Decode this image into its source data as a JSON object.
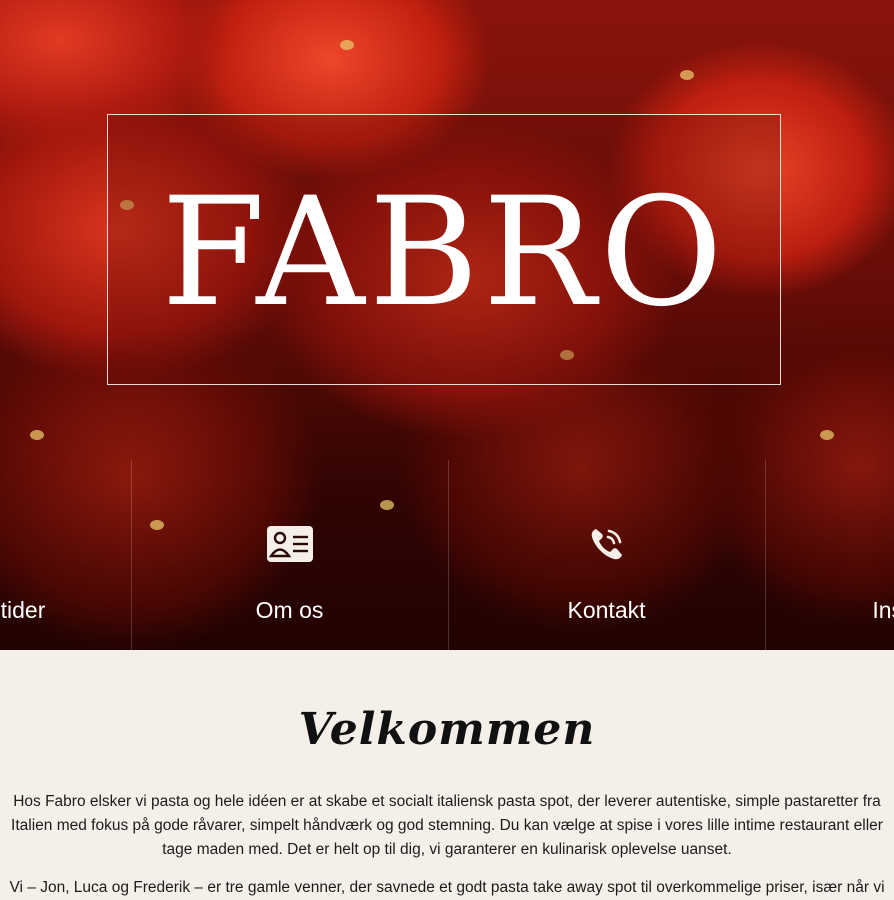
{
  "brand": {
    "logo_text": "FABRO"
  },
  "nav": {
    "items": [
      {
        "label": "Retter og tider",
        "icon": "menu-icon"
      },
      {
        "label": "Om os",
        "icon": "id-card-icon"
      },
      {
        "label": "Kontakt",
        "icon": "phone-icon"
      },
      {
        "label": "Instagram",
        "icon": "instagram-icon"
      }
    ]
  },
  "welcome": {
    "title": "Velkommen",
    "paragraph_1": "Hos Fabro elsker vi pasta og hele idéen er at skabe et socialt italiensk pasta spot, der leverer autentiske, simple pastaretter fra Italien med fokus på gode råvarer, simpelt håndværk og god stemning. Du kan vælge at spise i vores lille intime restaurant eller tage maden med. Det er helt op til dig, vi garanterer en kulinarisk oplevelse uanset.",
    "paragraph_2": "Vi – Jon, Luca og Frederik – er tre gamle venner, der savnede et godt pasta take away spot til overkommelige priser, især når vi"
  },
  "colors": {
    "hero_red": "#b01a10",
    "page_bg": "#f4efe8",
    "text": "#1c1c1c"
  }
}
